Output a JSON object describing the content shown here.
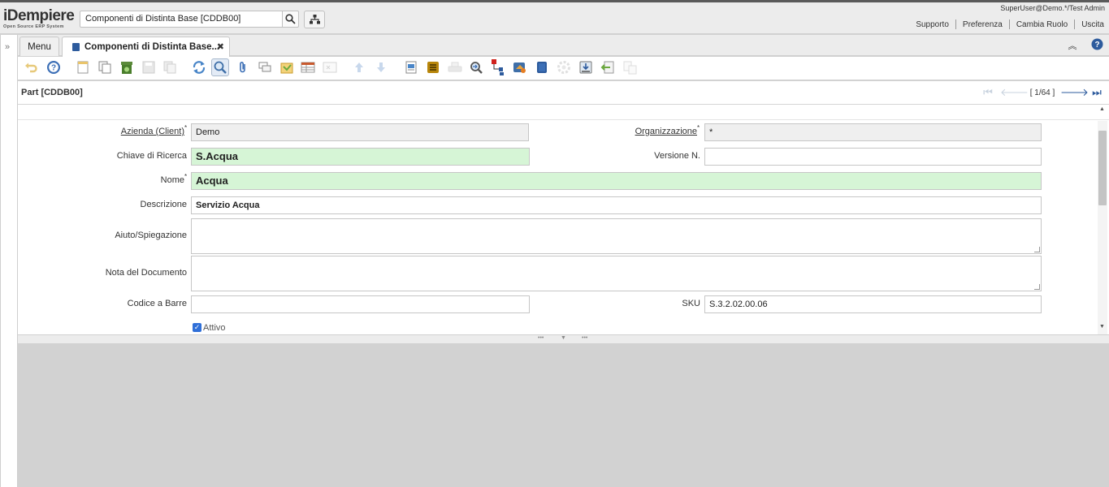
{
  "app": {
    "logo_title": "iDempiere",
    "logo_subtitle": "Open Source ERP System",
    "search_value": "Componenti di Distinta Base [CDDB00]",
    "user": "SuperUser@Demo.*/Test Admin",
    "links": [
      "Supporto",
      "Preferenza",
      "Cambia Ruolo",
      "Uscita"
    ]
  },
  "tabs": {
    "menu": "Menu",
    "active": "Componenti di Distinta Base..."
  },
  "breadcrumb": {
    "title": "Part [CDDB00]",
    "record": "[ 1/64 ]"
  },
  "toolbar_icons": [
    "undo-icon",
    "help-icon",
    "new-icon",
    "copy-icon",
    "delete-icon",
    "save-icon",
    "save-create-icon",
    "refresh-icon",
    "find-icon",
    "attachment-icon",
    "chat-icon",
    "postit-icon",
    "grid-toggle-icon",
    "detail-icon",
    "parent-record-icon",
    "child-record-icon",
    "report-icon",
    "archive-icon",
    "print-icon",
    "zoom-across-icon",
    "active-workflows-icon",
    "requests-icon",
    "product-info-icon",
    "process-icon",
    "export-icon",
    "import-icon",
    "customize-icon"
  ],
  "form": {
    "client_label": "Azienda (Client)",
    "client_value": "Demo",
    "org_label": "Organizzazione",
    "org_value": "*",
    "search_key_label": "Chiave di Ricerca",
    "search_key_value": "S.Acqua",
    "version_label": "Versione N.",
    "version_value": "",
    "name_label": "Nome",
    "name_value": "Acqua",
    "description_label": "Descrizione",
    "description_value": "Servizio Acqua",
    "help_label": "Aiuto/Spiegazione",
    "help_value": "",
    "docnote_label": "Nota del Documento",
    "docnote_value": "",
    "barcode_label": "Codice a Barre",
    "barcode_value": "",
    "sku_label": "SKU",
    "sku_value": "S.3.2.02.00.06",
    "active_label": "Attivo",
    "active_checked": true
  },
  "colors": {
    "mandatory_bg": "#d6f5d6",
    "readonly_bg": "#efefef",
    "accent": "#2d5b9d"
  }
}
